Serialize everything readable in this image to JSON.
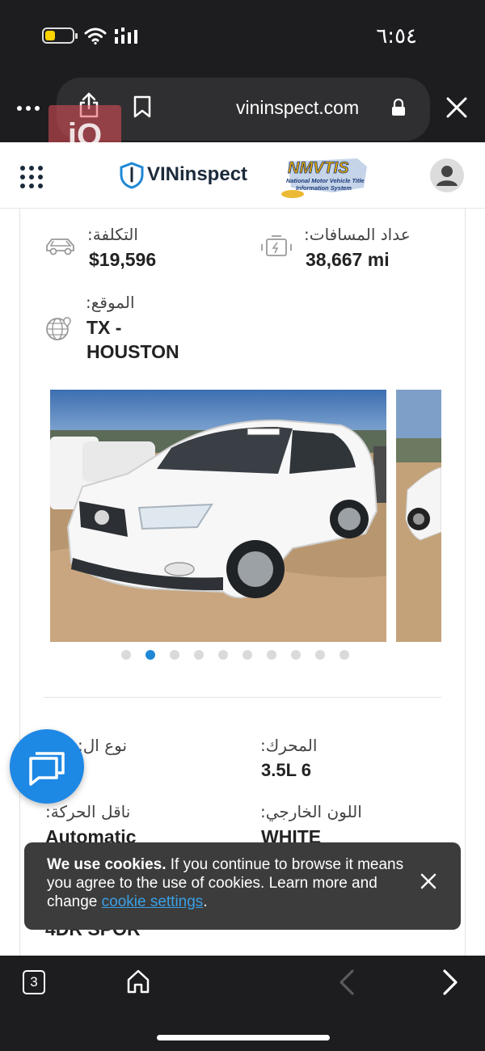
{
  "status_bar": {
    "time": "٦:٥٤"
  },
  "browser": {
    "url": "vininspect.com",
    "watermark": "iQ",
    "tab_count": "3"
  },
  "header": {
    "brand": "VINinspect",
    "nmvtis_title": "NMVTIS",
    "nmvtis_subtitle_1": "National Motor Vehicle Title",
    "nmvtis_subtitle_2": "Information System"
  },
  "details": {
    "cost_label": ":التكلفة",
    "cost_value": "$19,596",
    "odometer_label": ":عداد المسافات",
    "odometer_value": "38,667 mi",
    "location_label": ":الموقع",
    "location_value_1": "TX -",
    "location_value_2": "HOUSTON",
    "type_label": ":نوع ال",
    "type_value": "",
    "engine_label": ":المحرك",
    "engine_value": "3.5L 6",
    "transmission_label": ":ناقل الحركة",
    "transmission_value": "Automatic",
    "color_label": ":اللون الخارجي",
    "color_value": "WHITE",
    "body_value": "4DR SPOR"
  },
  "gallery": {
    "dot_count": 10,
    "active_index": 1,
    "accent_color": "#1e88d6"
  },
  "cookie": {
    "bold": "We use cookies.",
    "text_1": " If you continue to browse it means you agree to the use of cookies. Learn more and change ",
    "link": "cookie settings",
    "text_2": "."
  },
  "icons": [
    "battery-icon",
    "wifi-icon",
    "signal-icon",
    "more-icon",
    "share-icon",
    "bookmark-icon",
    "lock-icon",
    "close-icon",
    "grid-icon",
    "shield-icon",
    "avatar-icon",
    "car-icon",
    "engine-icon",
    "globe-icon",
    "chat-icon",
    "home-icon",
    "back-icon",
    "forward-icon"
  ]
}
